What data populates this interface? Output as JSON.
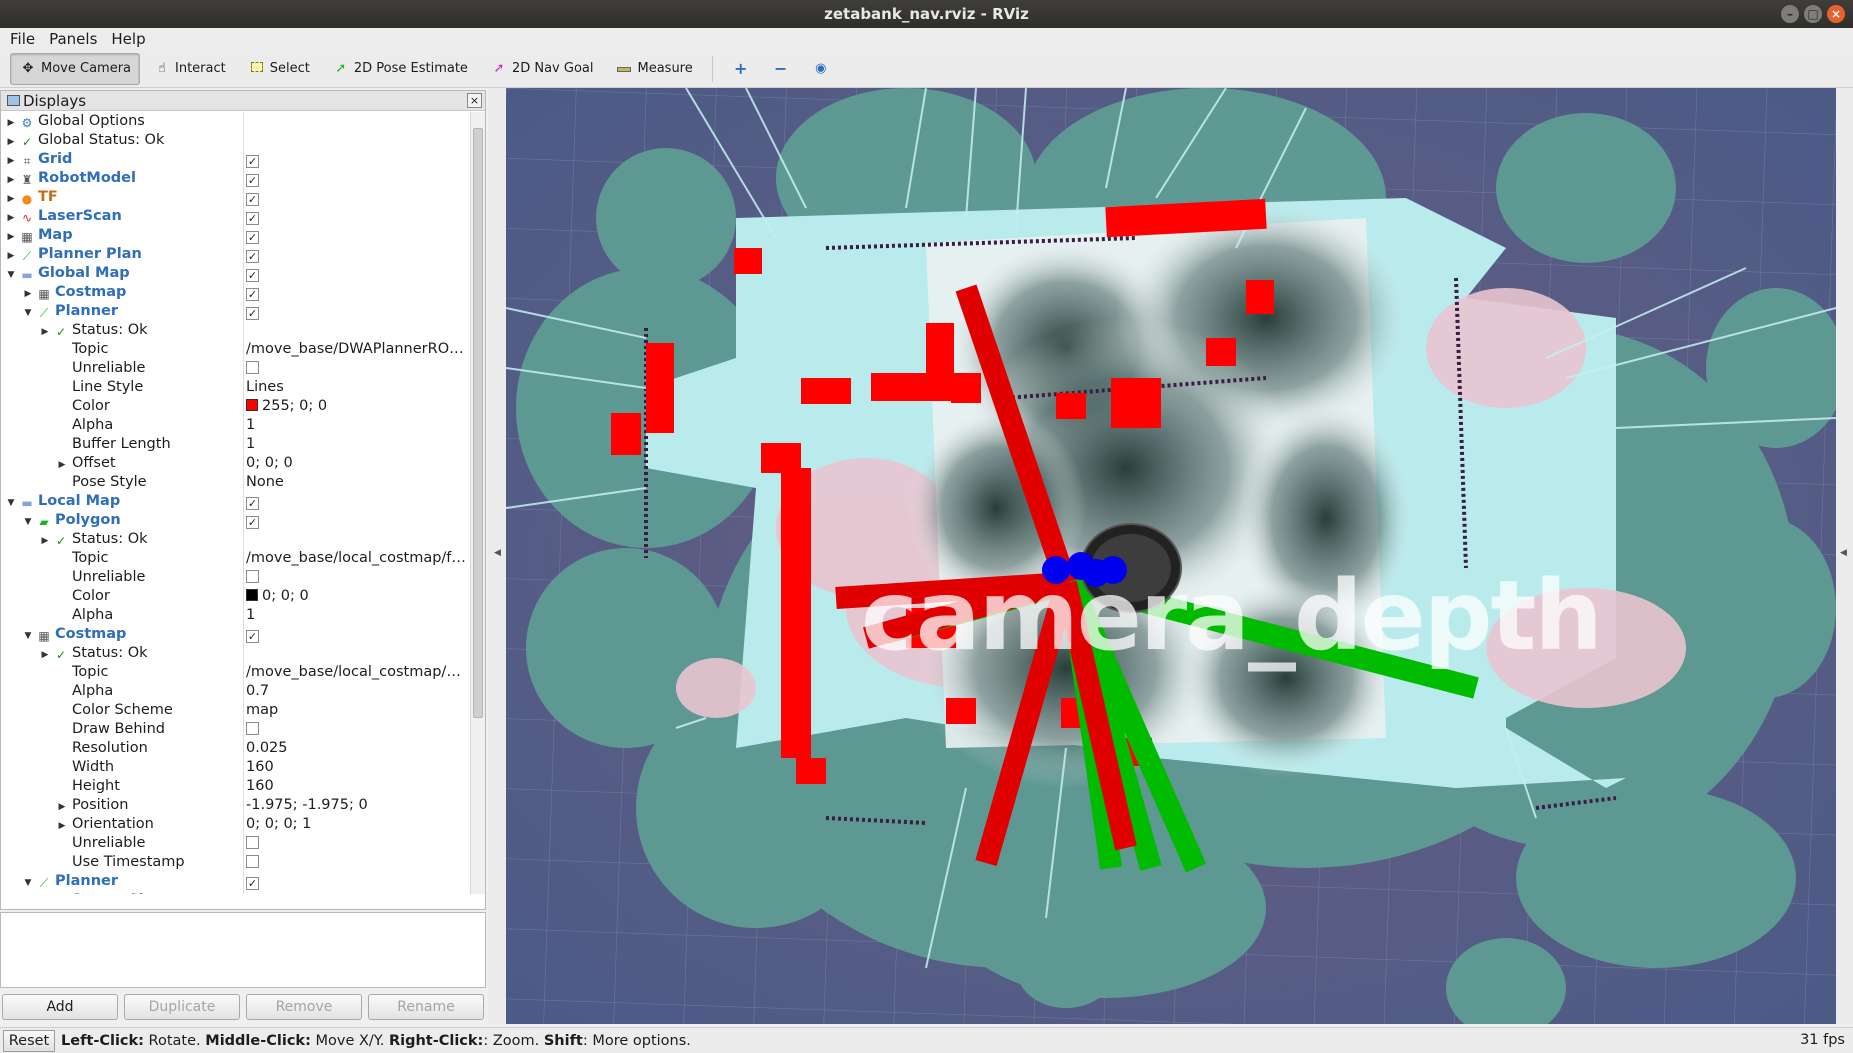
{
  "window": {
    "title": "zetabank_nav.rviz - RViz"
  },
  "menu": {
    "items": [
      {
        "label": "File"
      },
      {
        "label": "Panels"
      },
      {
        "label": "Help"
      }
    ]
  },
  "toolbar": {
    "move_camera": "Move Camera",
    "interact": "Interact",
    "select": "Select",
    "pose_estimate": "2D Pose Estimate",
    "nav_goal": "2D Nav Goal",
    "measure": "Measure"
  },
  "displays_panel": {
    "title": "Displays",
    "rows": [
      {
        "name": "Global Options",
        "value": ""
      },
      {
        "name": "Global Status: Ok",
        "value": ""
      },
      {
        "name": "Grid",
        "value": "✓"
      },
      {
        "name": "RobotModel",
        "value": "✓"
      },
      {
        "name": "TF",
        "value": "✓"
      },
      {
        "name": "LaserScan",
        "value": "✓"
      },
      {
        "name": "Map",
        "value": "✓"
      },
      {
        "name": "Planner Plan",
        "value": "✓"
      },
      {
        "name": "Global Map",
        "value": "✓"
      },
      {
        "name": "Costmap",
        "value": "✓"
      },
      {
        "name": "Planner",
        "value": "✓"
      },
      {
        "name": "Status: Ok",
        "value": ""
      },
      {
        "name": "Topic",
        "value": "/move_base/DWAPlannerROS..."
      },
      {
        "name": "Unreliable",
        "value": ""
      },
      {
        "name": "Line Style",
        "value": "Lines"
      },
      {
        "name": "Color",
        "value": "255; 0; 0"
      },
      {
        "name": "Alpha",
        "value": "1"
      },
      {
        "name": "Buffer Length",
        "value": "1"
      },
      {
        "name": "Offset",
        "value": "0; 0; 0"
      },
      {
        "name": "Pose Style",
        "value": "None"
      },
      {
        "name": "Local Map",
        "value": "✓"
      },
      {
        "name": "Polygon",
        "value": "✓"
      },
      {
        "name": "Status: Ok",
        "value": ""
      },
      {
        "name": "Topic",
        "value": "/move_base/local_costmap/fo..."
      },
      {
        "name": "Unreliable",
        "value": ""
      },
      {
        "name": "Color",
        "value": "0; 0; 0"
      },
      {
        "name": "Alpha",
        "value": "1"
      },
      {
        "name": "Costmap",
        "value": "✓"
      },
      {
        "name": "Status: Ok",
        "value": ""
      },
      {
        "name": "Topic",
        "value": "/move_base/local_costmap/co..."
      },
      {
        "name": "Alpha",
        "value": "0.7"
      },
      {
        "name": "Color Scheme",
        "value": "map"
      },
      {
        "name": "Draw Behind",
        "value": ""
      },
      {
        "name": "Resolution",
        "value": "0.025"
      },
      {
        "name": "Width",
        "value": "160"
      },
      {
        "name": "Height",
        "value": "160"
      },
      {
        "name": "Position",
        "value": "-1.975; -1.975; 0"
      },
      {
        "name": "Orientation",
        "value": "0; 0; 0; 1"
      },
      {
        "name": "Unreliable",
        "value": ""
      },
      {
        "name": "Use Timestamp",
        "value": ""
      },
      {
        "name": "Planner",
        "value": "✓"
      },
      {
        "name": "Status: Ok",
        "value": ""
      }
    ],
    "buttons": {
      "add": "Add",
      "duplicate": "Duplicate",
      "remove": "Remove",
      "rename": "Rename"
    }
  },
  "viewport": {
    "overlay_text": "camera_depth"
  },
  "status": {
    "reset": "Reset",
    "hint_left_key": "Left-Click:",
    "hint_left": " Rotate. ",
    "hint_middle_key": "Middle-Click:",
    "hint_middle": " Move X/Y. ",
    "hint_right_key": "Right-Click:",
    "hint_right": ": Zoom. ",
    "hint_shift_key": "Shift",
    "hint_shift": ": More options.",
    "fps": "31 fps"
  },
  "colors": {
    "planner_color": "#ff0000",
    "polygon_color": "#000000",
    "accent": "#2f6dbd"
  }
}
